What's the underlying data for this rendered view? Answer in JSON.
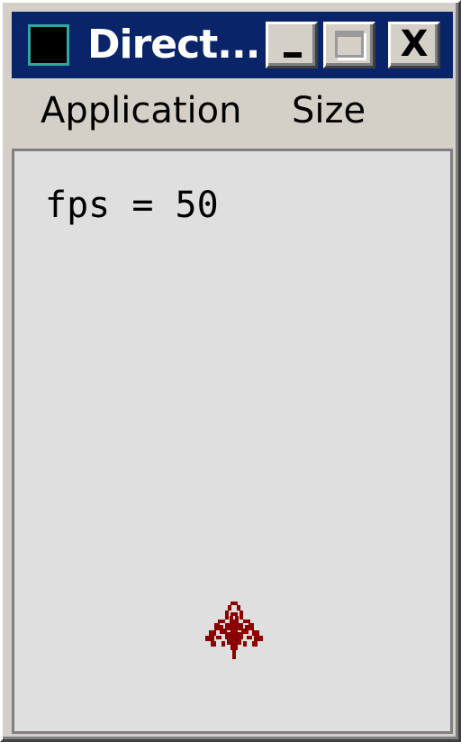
{
  "window": {
    "title": "Direct...",
    "icon": "app-icon",
    "buttons": {
      "minimize": "minimize-icon",
      "maximize": "maximize-icon",
      "close_label": "X"
    }
  },
  "menubar": {
    "items": [
      {
        "label": "Application"
      },
      {
        "label": "Size"
      }
    ]
  },
  "client": {
    "fps_text": "fps = 50",
    "sprite": "spaceship-icon",
    "sprite_color": "#8b0000"
  }
}
